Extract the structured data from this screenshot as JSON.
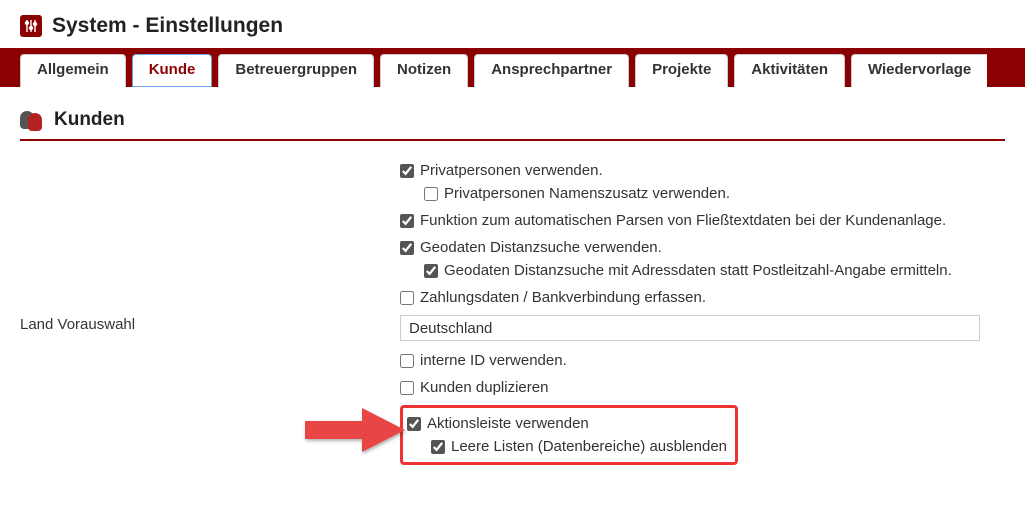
{
  "header": {
    "title": "System - Einstellungen"
  },
  "tabs": [
    {
      "label": "Allgemein"
    },
    {
      "label": "Kunde"
    },
    {
      "label": "Betreuergruppen"
    },
    {
      "label": "Notizen"
    },
    {
      "label": "Ansprechpartner"
    },
    {
      "label": "Projekte"
    },
    {
      "label": "Aktivitäten"
    },
    {
      "label": "Wiedervorlage"
    }
  ],
  "section": {
    "title": "Kunden"
  },
  "settings": {
    "privatpersonen": {
      "label": "Privatpersonen verwenden.",
      "checked": true
    },
    "privatpersonen_namenszusatz": {
      "label": "Privatpersonen Namenszusatz verwenden.",
      "checked": false
    },
    "auto_parse": {
      "label": "Funktion zum automatischen Parsen von Fließtextdaten bei der Kundenanlage.",
      "checked": true
    },
    "geodaten_distanz": {
      "label": "Geodaten Distanzsuche verwenden.",
      "checked": true
    },
    "geodaten_adressdaten": {
      "label": "Geodaten Distanzsuche mit Adressdaten statt Postleitzahl-Angabe ermitteln.",
      "checked": true
    },
    "zahlungsdaten": {
      "label": "Zahlungsdaten / Bankverbindung erfassen.",
      "checked": false
    },
    "land_vorauswahl_label": "Land Vorauswahl",
    "land_vorauswahl_value": "Deutschland",
    "interne_id": {
      "label": "interne ID verwenden.",
      "checked": false
    },
    "kunden_duplizieren": {
      "label": "Kunden duplizieren",
      "checked": false
    },
    "aktionsleiste": {
      "label": "Aktionsleiste verwenden",
      "checked": true
    },
    "leere_listen": {
      "label": "Leere Listen (Datenbereiche) ausblenden",
      "checked": true
    }
  }
}
